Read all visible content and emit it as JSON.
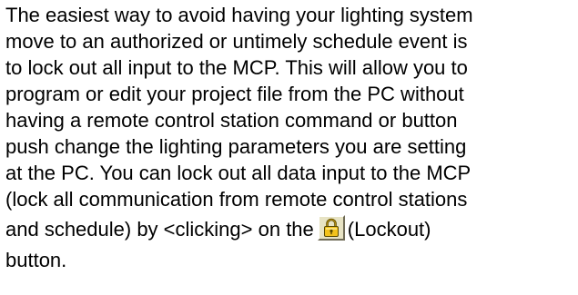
{
  "paragraph": {
    "lines": [
      "The easiest way to avoid having your lighting system",
      "move to an authorized or untimely schedule event is",
      "to lock out all input to the MCP. This will allow you to",
      "program or edit your project file from the PC without",
      "having a remote control station command or button",
      "push change the lighting parameters you are setting",
      "at the PC. You can lock out all data input to the MCP",
      "(lock all communication from remote control stations"
    ],
    "icon_line_before": "and schedule) by <clicking> on the",
    "icon_line_after": "(Lockout)",
    "last_line": "button."
  },
  "icon": {
    "name": "lockout-padlock-icon",
    "colors": {
      "button_face": "#e7e3c4",
      "lock_body": "#f2c21b",
      "lock_shackle": "#b08a10",
      "outline": "#5a4a00"
    }
  }
}
